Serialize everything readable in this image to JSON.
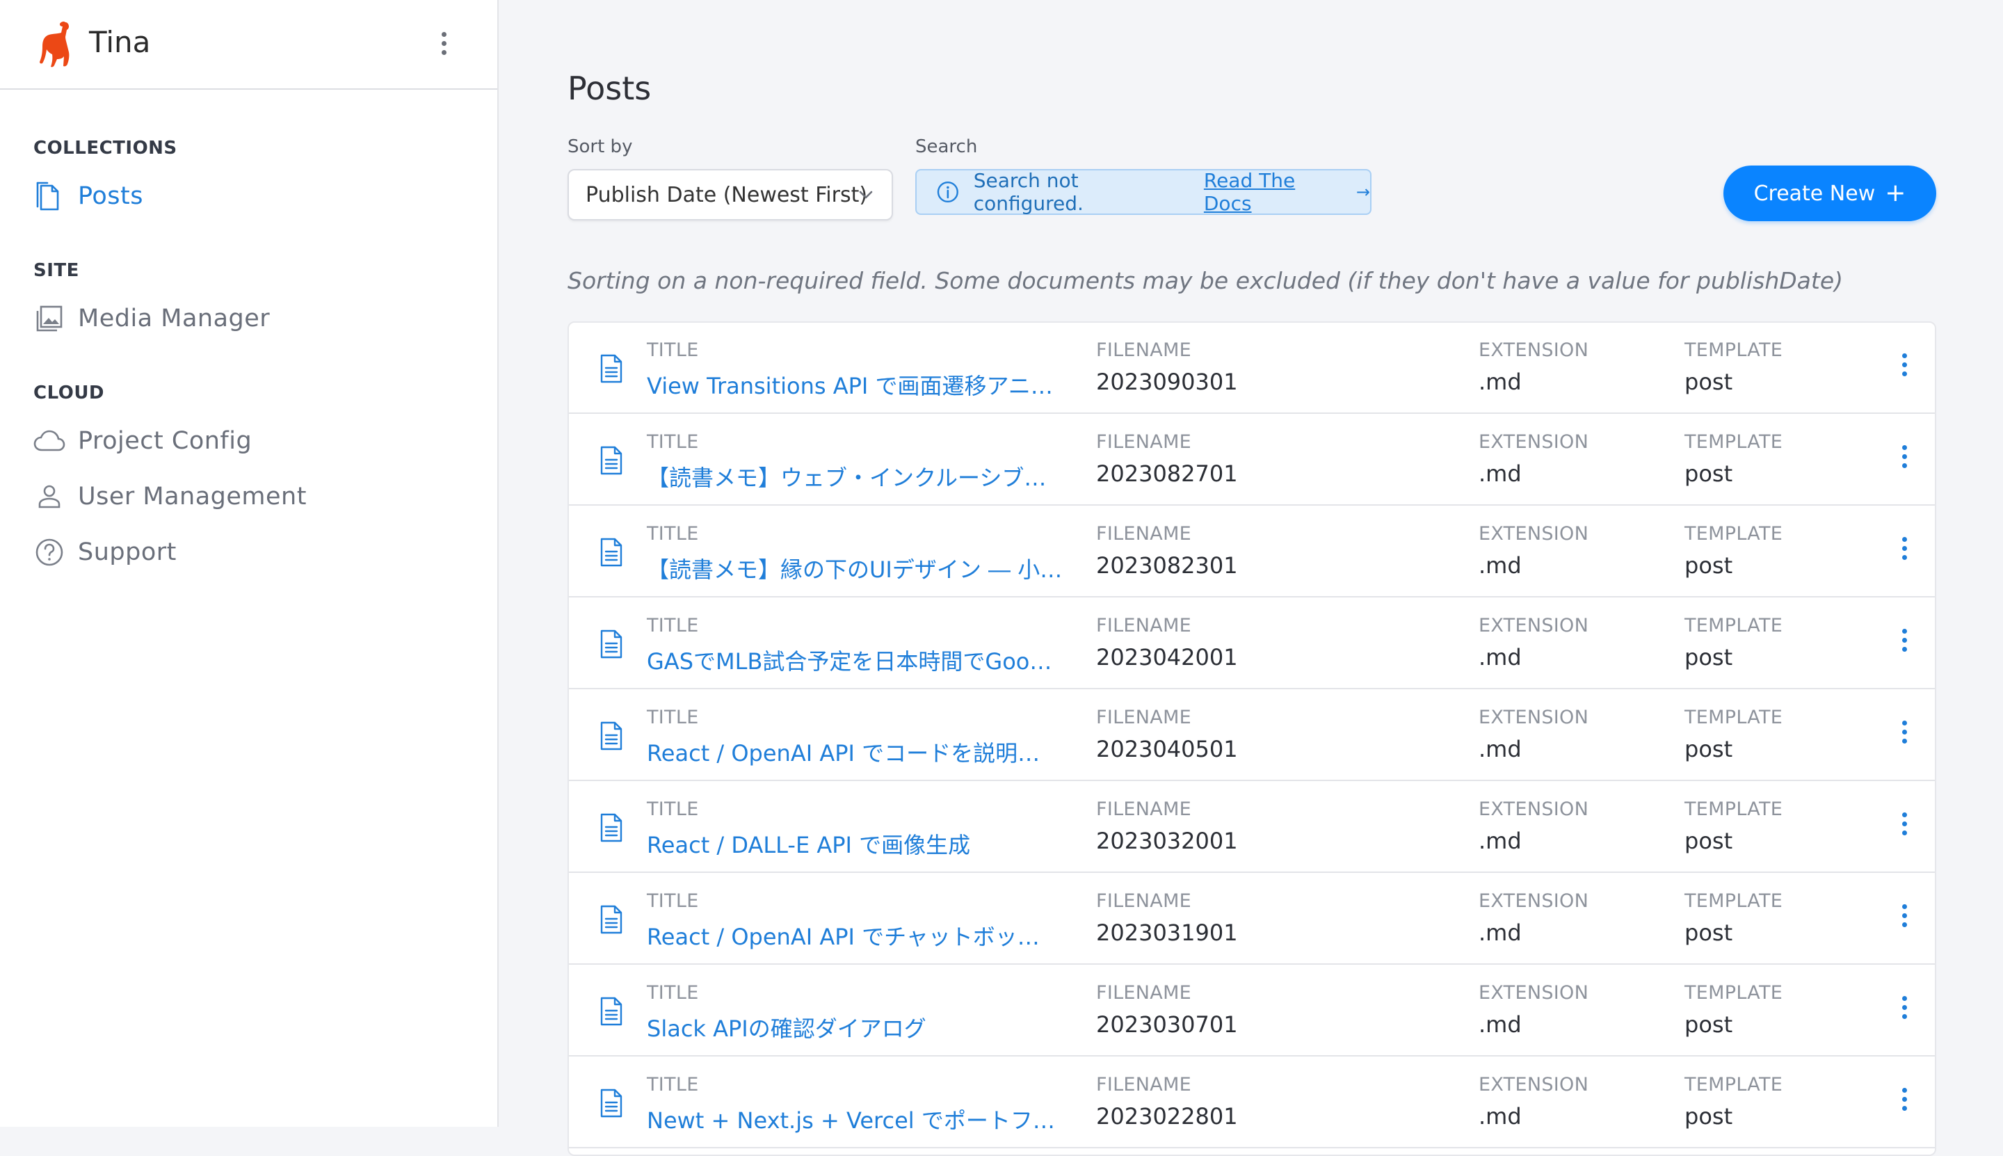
{
  "app": {
    "brand": "Tina"
  },
  "sidebar": {
    "sections": [
      {
        "title": "COLLECTIONS",
        "items": [
          {
            "label": "Posts",
            "icon": "document-icon",
            "active": true
          }
        ]
      },
      {
        "title": "SITE",
        "items": [
          {
            "label": "Media Manager",
            "icon": "image-icon"
          }
        ]
      },
      {
        "title": "CLOUD",
        "items": [
          {
            "label": "Project Config",
            "icon": "cloud-icon"
          },
          {
            "label": "User Management",
            "icon": "user-icon"
          },
          {
            "label": "Support",
            "icon": "help-icon"
          }
        ]
      }
    ]
  },
  "main": {
    "title": "Posts",
    "sort": {
      "label": "Sort by",
      "value": "Publish Date (Newest First)"
    },
    "search": {
      "label": "Search",
      "message": "Search not configured.",
      "link": "Read The Docs",
      "arrow": "→"
    },
    "create_button": "Create New",
    "notice": "Sorting on a non-required field. Some documents may be excluded (if they don't have a value for publishDate)",
    "columns": {
      "title": "TITLE",
      "filename": "FILENAME",
      "extension": "EXTENSION",
      "template": "TEMPLATE"
    },
    "rows": [
      {
        "title": "View Transitions API で画面遷移アニ…",
        "filename": "2023090301",
        "extension": ".md",
        "template": "post"
      },
      {
        "title": "【読書メモ】ウェブ・インクルーシブ…",
        "filename": "2023082701",
        "extension": ".md",
        "template": "post"
      },
      {
        "title": "【読書メモ】縁の下のUIデザイン ― 小…",
        "filename": "2023082301",
        "extension": ".md",
        "template": "post"
      },
      {
        "title": "GASでMLB試合予定を日本時間でGoo…",
        "filename": "2023042001",
        "extension": ".md",
        "template": "post"
      },
      {
        "title": "React / OpenAI API でコードを説明…",
        "filename": "2023040501",
        "extension": ".md",
        "template": "post"
      },
      {
        "title": "React / DALL-E API で画像生成",
        "filename": "2023032001",
        "extension": ".md",
        "template": "post"
      },
      {
        "title": "React / OpenAI API でチャットボッ…",
        "filename": "2023031901",
        "extension": ".md",
        "template": "post"
      },
      {
        "title": "Slack APIの確認ダイアログ",
        "filename": "2023030701",
        "extension": ".md",
        "template": "post"
      },
      {
        "title": "Newt + Next.js + Vercel でポートフ…",
        "filename": "2023022801",
        "extension": ".md",
        "template": "post"
      }
    ]
  },
  "colors": {
    "accent": "#0a84ff",
    "link": "#1f7ed9",
    "logo": "#ec4815",
    "search_bg": "#dcecfb"
  }
}
